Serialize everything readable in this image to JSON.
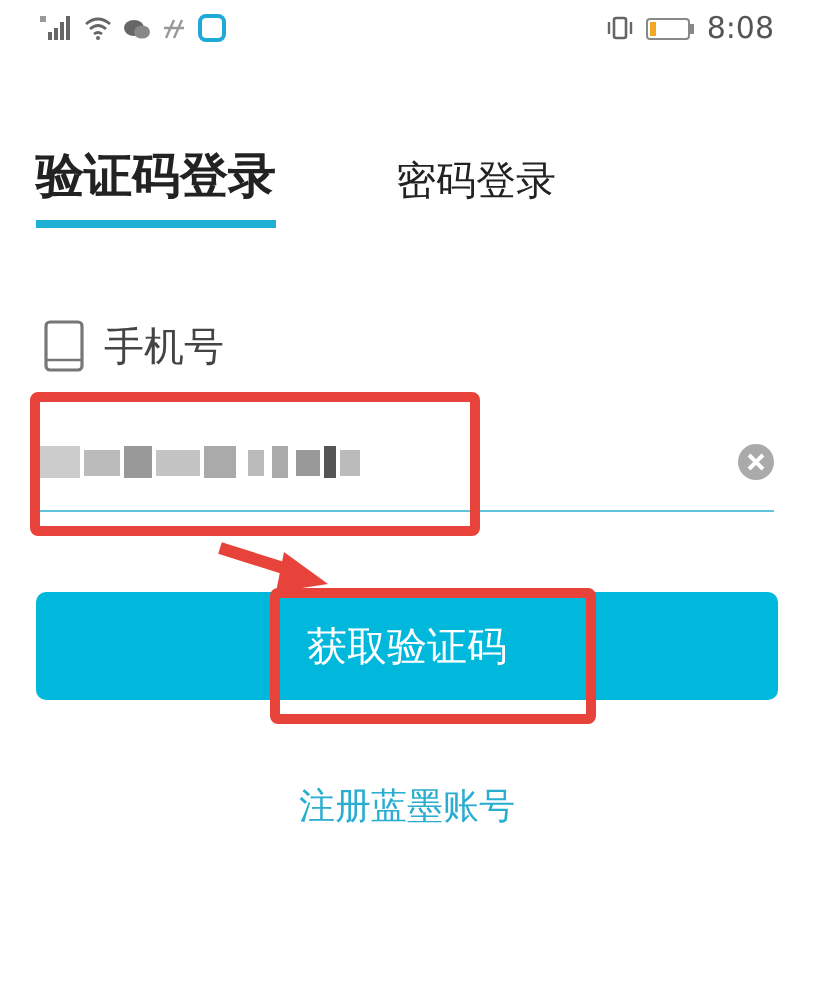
{
  "status_bar": {
    "time": "8:08",
    "battery": {
      "level": 0.15
    }
  },
  "tabs": [
    {
      "label": "验证码登录",
      "selected": true
    },
    {
      "label": "密码登录",
      "selected": false
    }
  ],
  "phone_field": {
    "label": "手机号"
  },
  "primary_button": "获取验证码",
  "register_link": "注册蓝墨账号"
}
